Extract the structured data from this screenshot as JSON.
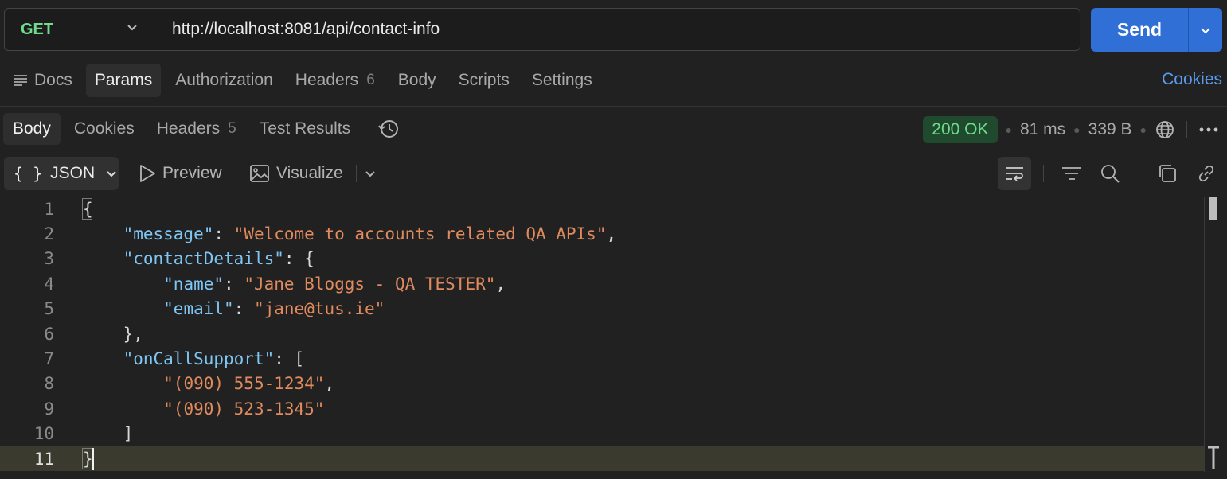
{
  "request": {
    "method": "GET",
    "url": "http://localhost:8081/api/contact-info",
    "send_label": "Send"
  },
  "request_tabs": [
    {
      "label": "Docs"
    },
    {
      "label": "Params"
    },
    {
      "label": "Authorization"
    },
    {
      "label": "Headers",
      "count": "6"
    },
    {
      "label": "Body"
    },
    {
      "label": "Scripts"
    },
    {
      "label": "Settings"
    }
  ],
  "cookies_link": "Cookies",
  "response_tabs": [
    {
      "label": "Body"
    },
    {
      "label": "Cookies"
    },
    {
      "label": "Headers",
      "count": "5"
    },
    {
      "label": "Test Results"
    }
  ],
  "response_status": {
    "status": "200 OK",
    "time": "81 ms",
    "size": "339 B"
  },
  "toolbar": {
    "format": "JSON",
    "preview": "Preview",
    "visualize": "Visualize"
  },
  "code_lines": [
    {
      "n": "1"
    },
    {
      "n": "2"
    },
    {
      "n": "3"
    },
    {
      "n": "4"
    },
    {
      "n": "5"
    },
    {
      "n": "6"
    },
    {
      "n": "7"
    },
    {
      "n": "8"
    },
    {
      "n": "9"
    },
    {
      "n": "10"
    },
    {
      "n": "11"
    }
  ],
  "json": {
    "key_message": "\"message\"",
    "val_message": "\"Welcome to accounts related QA APIs\"",
    "key_contact": "\"contactDetails\"",
    "key_name": "\"name\"",
    "val_name": "\"Jane Bloggs - QA TESTER\"",
    "key_email": "\"email\"",
    "val_email": "\"jane@tus.ie\"",
    "key_oncall": "\"onCallSupport\"",
    "val_phone1": "\"(090) 555-1234\"",
    "val_phone2": "\"(090) 523-1345\""
  },
  "colors": {
    "accent": "#2f6fd6",
    "method": "#6fdc8c",
    "json_key": "#7fc6f5",
    "json_string": "#e08a5e"
  }
}
